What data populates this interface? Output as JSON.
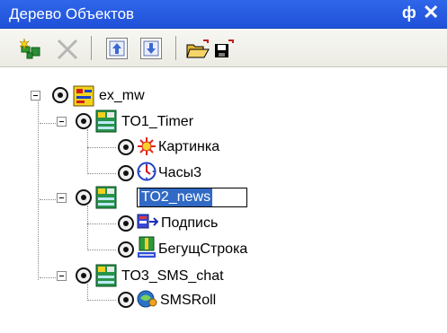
{
  "panel": {
    "title": "Дерево Объектов",
    "pin_glyph": "ф",
    "close_glyph": "✕"
  },
  "toolbar": {
    "buttons": [
      {
        "name": "add-object-button",
        "icon": "add-object-icon"
      },
      {
        "name": "delete-button",
        "icon": "delete-icon"
      },
      {
        "name": "move-up-button",
        "icon": "arrow-up-icon"
      },
      {
        "name": "move-down-button",
        "icon": "arrow-down-icon"
      },
      {
        "name": "open-button",
        "icon": "folder-open-icon"
      },
      {
        "name": "save-button",
        "icon": "floppy-disk-icon"
      }
    ]
  },
  "tree": {
    "root": {
      "label": "ex_mw",
      "icon": "project-icon"
    },
    "nodes": [
      {
        "label": "TO1_Timer",
        "icon": "screen-object-icon",
        "children": [
          {
            "label": "Картинка",
            "icon": "picture-icon"
          },
          {
            "label": "Часы3",
            "icon": "clock-icon"
          }
        ]
      },
      {
        "label": "TO2_news",
        "icon": "screen-object-icon",
        "editing": true,
        "children": [
          {
            "label": "Подпись",
            "icon": "caption-icon"
          },
          {
            "label": "БегущСтрока",
            "icon": "ticker-icon"
          }
        ]
      },
      {
        "label": "TO3_SMS_chat",
        "icon": "screen-object-icon",
        "children": [
          {
            "label": "SMSRoll",
            "icon": "sms-roll-icon"
          }
        ]
      }
    ]
  },
  "colors": {
    "title_bar": "#2659e3",
    "selection": "#316ac5"
  }
}
